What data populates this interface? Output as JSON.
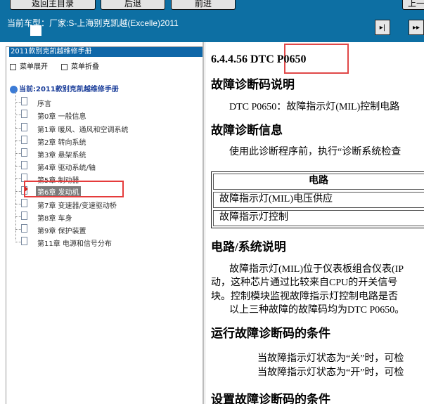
{
  "toolbar": {
    "back_label": "返回主目录",
    "prev_label": "后退",
    "next_label": "前进",
    "right_label": "上一"
  },
  "vehicle": {
    "label": "当前车型：厂家:S-上海别克凯越(Excelle)2011"
  },
  "nav": {
    "collapse_glyph": "▸|",
    "expand_glyph": "▸▸"
  },
  "sidebar": {
    "title": "2011款别克凯越维修手册",
    "expand_label": "菜单展开",
    "collapse_label": "菜单折叠",
    "root_label": "当前:2011款别克凯越维修手册",
    "items": [
      {
        "label": "序言"
      },
      {
        "label": "第0章 一般信息"
      },
      {
        "label": "第1章 暖风、通风和空调系统"
      },
      {
        "label": "第2章 转向系统"
      },
      {
        "label": "第3章 悬架系统"
      },
      {
        "label": "第4章 驱动系统/轴"
      },
      {
        "label": "第5章 制动器"
      },
      {
        "label": "第6章 发动机"
      },
      {
        "label": "第7章 变速器/变速驱动桥"
      },
      {
        "label": "第8章 车身"
      },
      {
        "label": "第9章 保护装置"
      },
      {
        "label": "第11章 电源和信号分布"
      }
    ],
    "selected_index": 7
  },
  "content": {
    "title": "6.4.4.56 DTC P0650",
    "desc_heading": "故障诊断码说明",
    "desc_text": "DTC P0650：故障指示灯(MIL)控制电路",
    "info_heading": "故障诊断信息",
    "info_text": "使用此诊断程序前，执行“诊断系统检查",
    "table_header": "电路",
    "table_rows": [
      "故障指示灯(MIL)电压供应",
      "故障指示灯控制"
    ],
    "circuit_heading": "电路/系统说明",
    "circuit_p1": "故障指示灯(MIL)位于仪表板组合仪表(IP",
    "circuit_p2": "动，这种芯片通过比较来自CPU的开关信号",
    "circuit_p3": "块。控制模块监视故障指示灯控制电路是否",
    "circuit_p4": "以上三种故障的故障码均为DTC P0650。",
    "run_heading": "运行故障诊断码的条件",
    "run_1": "当故障指示灯状态为“关”时，可检",
    "run_2": "当故障指示灯状态为“开”时，可检",
    "set_heading": "设置故障诊断码的条件"
  }
}
